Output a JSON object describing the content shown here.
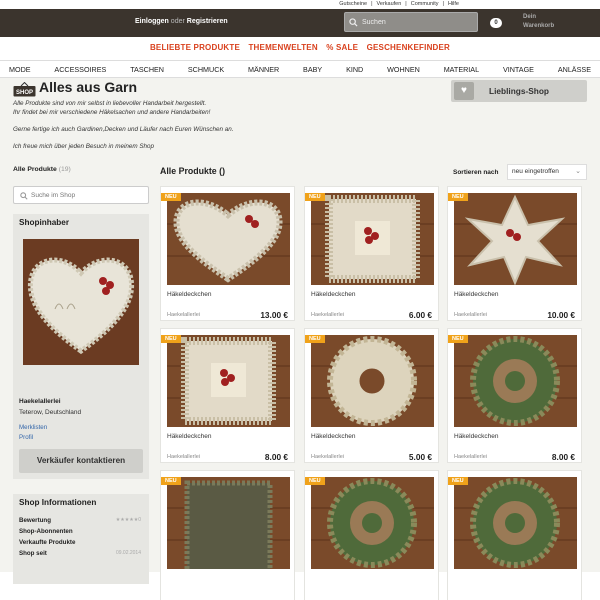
{
  "top_links": [
    "Gutscheine",
    "|",
    "Verkaufen",
    "|",
    "Community",
    "|",
    "Hilfe"
  ],
  "header": {
    "login": "Einloggen",
    "or": "oder",
    "register": "Registrieren",
    "search_placeholder": "Suchen",
    "cart_count": "0",
    "cart_label": "Dein Warenkorb"
  },
  "promo": [
    "BELIEBTE PRODUKTE",
    "THEMENWELTEN",
    "% SALE",
    "GESCHENKEFINDER"
  ],
  "categories": [
    "MODE",
    "ACCESSOIRES",
    "TASCHEN",
    "SCHMUCK",
    "MÄNNER",
    "BABY",
    "KIND",
    "WOHNEN",
    "MATERIAL",
    "VINTAGE",
    "ANLÄSSE"
  ],
  "shop": {
    "name": "Alles aus Garn",
    "icon_label": "SHOP",
    "desc1": "Alle Produkte sind von mir selbst in liebevoller Handarbeit hergestellt.",
    "desc2": "Ihr findet bei mir verschiedene Häkelsachen und andere Handarbeiten!",
    "desc3": "Gerne fertige ich auch Gardinen,Decken und Läufer nach Euren Wünschen an.",
    "desc4": "Ich freue mich über jeden Besuch in meinem Shop",
    "fav_button": "Lieblings-Shop"
  },
  "sidebar": {
    "all_products": "Alle Produkte",
    "all_products_count": "(19)",
    "search_placeholder": "Suche im Shop",
    "owner_title": "Shopinhaber",
    "owner_name": "Haekelallerlei",
    "owner_location": "Teterow, Deutschland",
    "link_merklisten": "Merklisten",
    "link_profil": "Profil",
    "contact_button": "Verkäufer kontaktieren",
    "info_title": "Shop Informationen",
    "info_rows": [
      {
        "label": "Bewertung",
        "value": "★★★★★0"
      },
      {
        "label": "Shop-Abonnenten",
        "value": ""
      },
      {
        "label": "Verkaufte Produkte",
        "value": ""
      },
      {
        "label": "Shop seit",
        "value": "09.02.2014"
      }
    ]
  },
  "grid": {
    "title": "Alle Produkte",
    "title_suffix": "()",
    "sort_label": "Sortieren nach",
    "sort_value": "neu eingetroffen",
    "badge": "NEU",
    "products": [
      {
        "title": "Häkeldeckchen",
        "seller": "Haekelallerlei",
        "price": "13.00 €",
        "motif": "heart"
      },
      {
        "title": "Häkeldeckchen",
        "seller": "Haekelallerlei",
        "price": "6.00 €",
        "motif": "square"
      },
      {
        "title": "Häkeldeckchen",
        "seller": "Haekelallerlei",
        "price": "10.00 €",
        "motif": "star"
      },
      {
        "title": "Häkeldeckchen",
        "seller": "Haekelallerlei",
        "price": "8.00 €",
        "motif": "square"
      },
      {
        "title": "Häkeldeckchen",
        "seller": "Haekelallerlei",
        "price": "5.00 €",
        "motif": "round"
      },
      {
        "title": "Häkeldeckchen",
        "seller": "Haekelallerlei",
        "price": "8.00 €",
        "motif": "green"
      },
      {
        "title": "",
        "seller": "",
        "price": "",
        "motif": "greensquare"
      },
      {
        "title": "",
        "seller": "",
        "price": "",
        "motif": "green"
      },
      {
        "title": "",
        "seller": "",
        "price": "",
        "motif": "green"
      }
    ]
  },
  "colors": {
    "topbar": "#3b342d",
    "accent": "#d9411e",
    "badge": "#f0a21a",
    "link": "#3366aa"
  }
}
